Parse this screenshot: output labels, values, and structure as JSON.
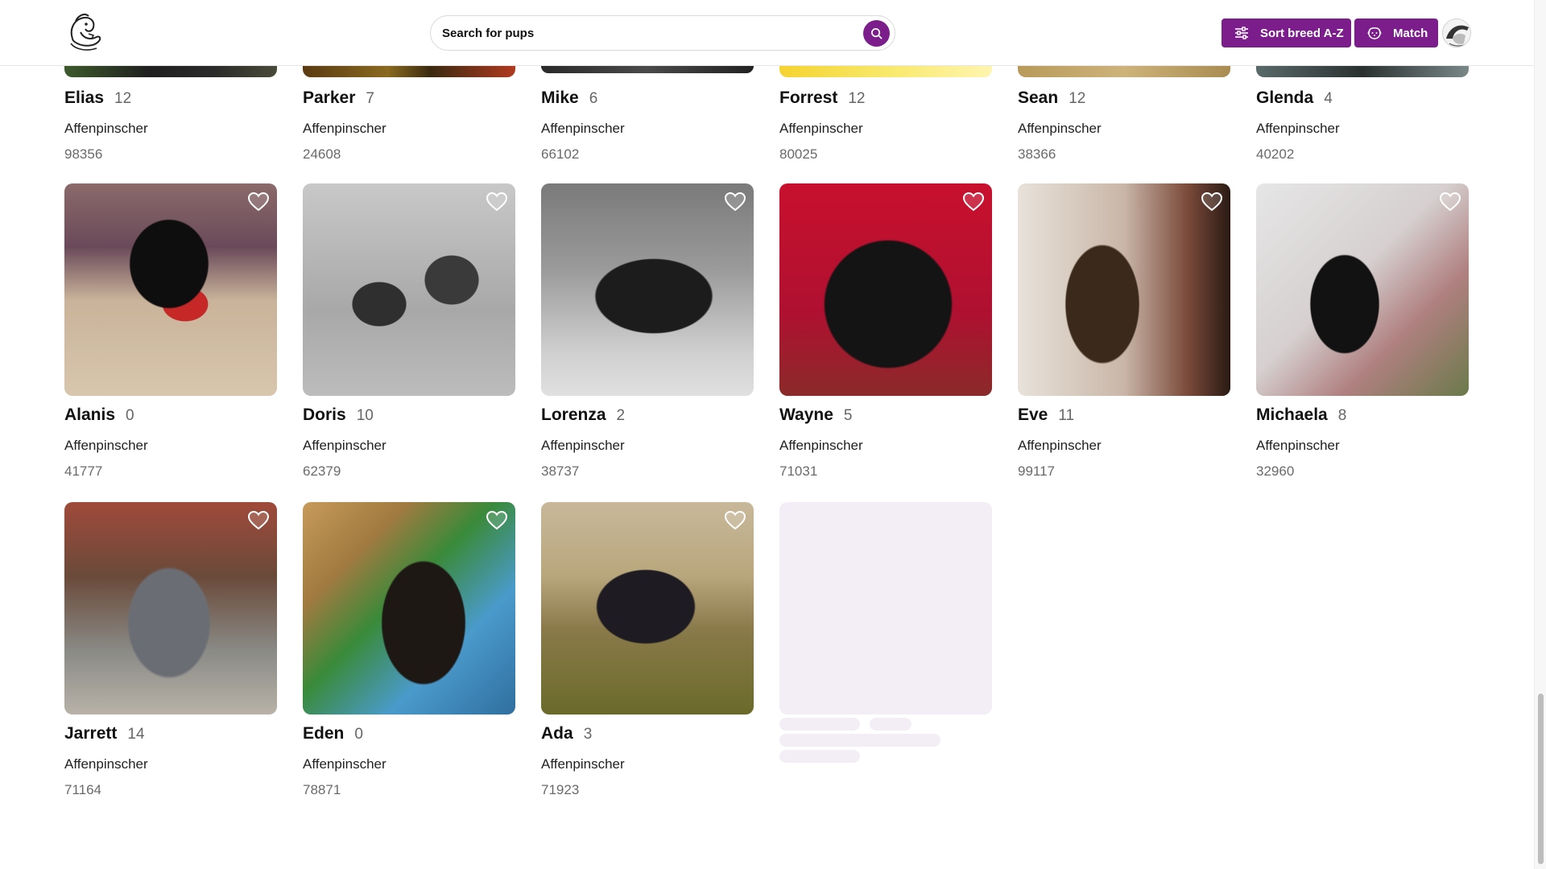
{
  "header": {
    "search_placeholder": "Search for pups",
    "sort_label": "Sort breed A-Z",
    "match_label": "Match",
    "accent_color": "#7b1e8c"
  },
  "top_row": [
    {
      "name": "Elias",
      "age": "12",
      "breed": "Affenpinscher",
      "zip": "98356"
    },
    {
      "name": "Parker",
      "age": "7",
      "breed": "Affenpinscher",
      "zip": "24608"
    },
    {
      "name": "Mike",
      "age": "6",
      "breed": "Affenpinscher",
      "zip": "66102"
    },
    {
      "name": "Forrest",
      "age": "12",
      "breed": "Affenpinscher",
      "zip": "80025"
    },
    {
      "name": "Sean",
      "age": "12",
      "breed": "Affenpinscher",
      "zip": "38366"
    },
    {
      "name": "Glenda",
      "age": "4",
      "breed": "Affenpinscher",
      "zip": "40202"
    }
  ],
  "middle_row": [
    {
      "name": "Alanis",
      "age": "0",
      "breed": "Affenpinscher",
      "zip": "41777"
    },
    {
      "name": "Doris",
      "age": "10",
      "breed": "Affenpinscher",
      "zip": "62379"
    },
    {
      "name": "Lorenza",
      "age": "2",
      "breed": "Affenpinscher",
      "zip": "38737"
    },
    {
      "name": "Wayne",
      "age": "5",
      "breed": "Affenpinscher",
      "zip": "71031"
    },
    {
      "name": "Eve",
      "age": "11",
      "breed": "Affenpinscher",
      "zip": "99117"
    },
    {
      "name": "Michaela",
      "age": "8",
      "breed": "Affenpinscher",
      "zip": "32960"
    }
  ],
  "bottom_row": [
    {
      "name": "Jarrett",
      "age": "14",
      "breed": "Affenpinscher",
      "zip": "71164"
    },
    {
      "name": "Eden",
      "age": "0",
      "breed": "Affenpinscher",
      "zip": "78871"
    },
    {
      "name": "Ada",
      "age": "3",
      "breed": "Affenpinscher",
      "zip": "71923"
    }
  ]
}
